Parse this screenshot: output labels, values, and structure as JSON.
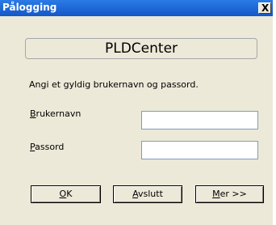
{
  "window": {
    "title": "Pålogging",
    "close_glyph": "X"
  },
  "banner": {
    "text": "PLDCenter"
  },
  "instruction": "Angi et gyldig brukernavn og passord.",
  "fields": {
    "username": {
      "label": "Brukernavn",
      "value": ""
    },
    "password": {
      "label": "Passord",
      "value": ""
    }
  },
  "buttons": {
    "ok": "OK",
    "exit": "Avslutt",
    "more": "Mer >>"
  }
}
